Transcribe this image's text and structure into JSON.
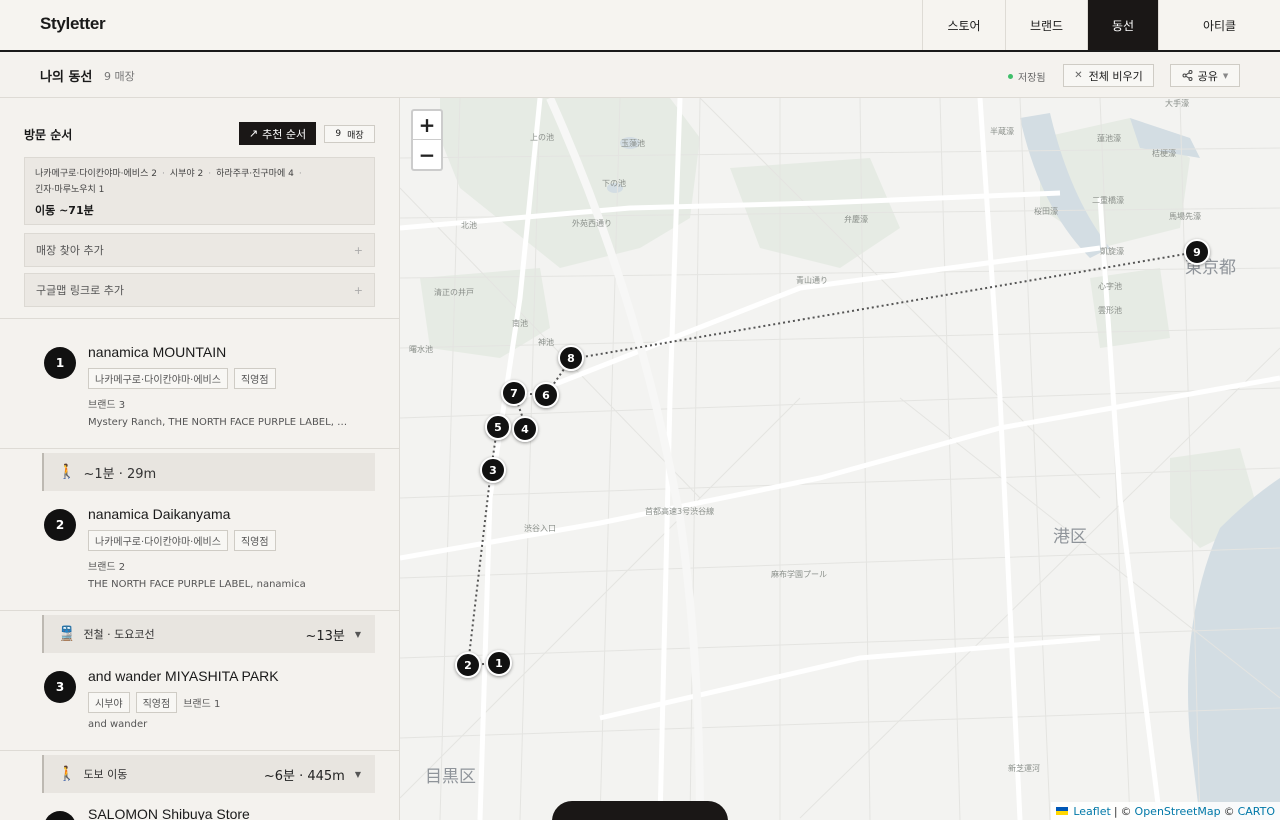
{
  "app": {
    "logo": "Styletter"
  },
  "nav": {
    "items": [
      {
        "label": "스토어",
        "active": false
      },
      {
        "label": "브랜드",
        "active": false
      },
      {
        "label": "동선",
        "active": true
      },
      {
        "label": "아티클",
        "active": false
      }
    ]
  },
  "subbar": {
    "title": "나의 동선",
    "count": "9 매장",
    "saved": "저장됨",
    "clear": "전체 비우기",
    "share": "공유"
  },
  "panel": {
    "visit_title": "방문 순서",
    "recommend": "추천 순서",
    "count_num": "9",
    "count_unit": "매장",
    "summary": {
      "areas": [
        "나카메구로·다이칸야마·에비스 2",
        "시부야 2",
        "하라주쿠·진구마에 4",
        "긴자·마루노우치 1"
      ],
      "total": "이동 ~71분"
    },
    "add_store": "매장 찾아 추가",
    "add_link": "구글맵 링크로 추가",
    "plus": "+"
  },
  "stores": [
    {
      "num": "1",
      "name": "nanamica MOUNTAIN",
      "tags": [
        "나카메구로·다이칸야마·에비스",
        "직영점"
      ],
      "brand_count": "브랜드 3",
      "brands": "Mystery Ranch, THE NORTH FACE PURPLE LABEL, nanamica"
    },
    {
      "num": "2",
      "name": "nanamica Daikanyama",
      "tags": [
        "나카메구로·다이칸야마·에비스",
        "직영점"
      ],
      "brand_count": "브랜드 2",
      "brands": "THE NORTH FACE PURPLE LABEL, nanamica"
    },
    {
      "num": "3",
      "name": "and wander MIYASHITA PARK",
      "tags": [
        "시부야",
        "직영점"
      ],
      "brand_count": "브랜드 1",
      "brands": "and wander"
    },
    {
      "num": "4",
      "name": "SALOMON Shibuya Store"
    }
  ],
  "transits": [
    {
      "icon": "🚶",
      "label": "~1분 · 29m",
      "time": ""
    },
    {
      "icon": "🚆",
      "label": "전철 · 도요코선",
      "time": "~13분"
    },
    {
      "icon": "🚶",
      "label": "도보 이동",
      "time": "~6분 · 445m"
    }
  ],
  "map": {
    "zoom_in": "+",
    "zoom_out": "−",
    "pins": [
      "1",
      "2",
      "3",
      "4",
      "5",
      "6",
      "7",
      "8",
      "9"
    ],
    "labels": {
      "minato": "港区",
      "tokyo": "東京都",
      "meguro": "目黒区",
      "kami": "上の池",
      "tamamo": "玉藻池",
      "shimo": "下の池",
      "kitaike": "北池",
      "kiyomasa": "清正の井戸",
      "nanchi": "南池",
      "kamiike": "神池",
      "kansui": "曙水池",
      "benkei": "弁慶濠",
      "hanzomon": "半蔵濠",
      "sakurada": "桜田濠",
      "nijubashi": "二重橋濠",
      "hibiya": "日比谷濠",
      "baba": "馬場先濠",
      "otemon": "大手濠",
      "kikyo": "桔梗濠",
      "hasuike": "蓮池濠",
      "ushigafuchi": "凱旋濠",
      "shinjiike": "心字池",
      "unkei": "雲形池",
      "azabu": "麻布学園プール",
      "shinshiba": "新芝運河",
      "shibuya_entrance": "渋谷入口",
      "expressway": "首都高速3号渋谷線",
      "aoyama": "青山通り",
      "koshu": "外苑西通り"
    },
    "attribution": {
      "leaflet": "Leaflet",
      "sep": "|",
      "copy1": "©",
      "osm": "OpenStreetMap",
      "copy2": "©",
      "carto": "CARTO"
    }
  }
}
